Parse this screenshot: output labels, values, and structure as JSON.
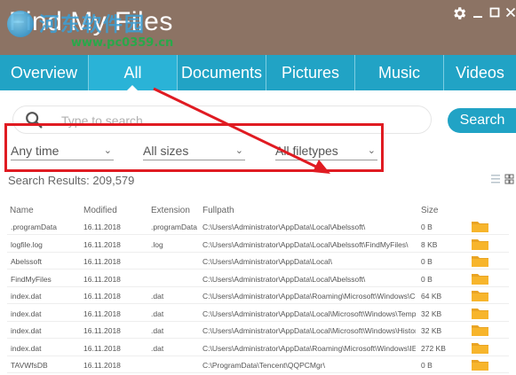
{
  "app": {
    "title": "Find My Files",
    "watermark_text": "河东软件园",
    "watermark_url": "www.pc0359.cn"
  },
  "window_controls": {
    "settings_icon": "gear-icon",
    "minimize": "▁",
    "maximize": "□",
    "close": "✕"
  },
  "tabs": [
    {
      "label": "Overview",
      "active": false
    },
    {
      "label": "All",
      "active": true
    },
    {
      "label": "Documents",
      "active": false
    },
    {
      "label": "Pictures",
      "active": false
    },
    {
      "label": "Music",
      "active": false
    },
    {
      "label": "Videos",
      "active": false
    }
  ],
  "search": {
    "placeholder": "Type to search",
    "button_label": "Search",
    "icon": "search-icon"
  },
  "filters": {
    "time": "Any time",
    "size": "All sizes",
    "filetype": "All filetypes"
  },
  "results": {
    "label": "Search Results:",
    "count": "209,579"
  },
  "table": {
    "columns": [
      "Name",
      "Modified",
      "Extension",
      "Fullpath",
      "Size"
    ],
    "rows": [
      {
        "name": ".programData",
        "modified": "16.11.2018",
        "extension": ".programData",
        "fullpath": "C:\\Users\\Administrator\\AppData\\Local\\Abelssoft\\",
        "size": "0 B"
      },
      {
        "name": "logfile.log",
        "modified": "16.11.2018",
        "extension": ".log",
        "fullpath": "C:\\Users\\Administrator\\AppData\\Local\\Abelssoft\\FindMyFiles\\",
        "size": "8 KB"
      },
      {
        "name": "Abelssoft",
        "modified": "16.11.2018",
        "extension": "",
        "fullpath": "C:\\Users\\Administrator\\AppData\\Local\\",
        "size": "0 B"
      },
      {
        "name": "FindMyFiles",
        "modified": "16.11.2018",
        "extension": "",
        "fullpath": "C:\\Users\\Administrator\\AppData\\Local\\Abelssoft\\",
        "size": "0 B"
      },
      {
        "name": "index.dat",
        "modified": "16.11.2018",
        "extension": ".dat",
        "fullpath": "C:\\Users\\Administrator\\AppData\\Roaming\\Microsoft\\Windows\\Coo...",
        "size": "64 KB"
      },
      {
        "name": "index.dat",
        "modified": "16.11.2018",
        "extension": ".dat",
        "fullpath": "C:\\Users\\Administrator\\AppData\\Local\\Microsoft\\Windows\\Tempor...",
        "size": "32 KB"
      },
      {
        "name": "index.dat",
        "modified": "16.11.2018",
        "extension": ".dat",
        "fullpath": "C:\\Users\\Administrator\\AppData\\Local\\Microsoft\\Windows\\History\\...",
        "size": "32 KB"
      },
      {
        "name": "index.dat",
        "modified": "16.11.2018",
        "extension": ".dat",
        "fullpath": "C:\\Users\\Administrator\\AppData\\Roaming\\Microsoft\\Windows\\IETl...",
        "size": "272 KB"
      },
      {
        "name": "TAVWfsDB",
        "modified": "16.11.2018",
        "extension": "",
        "fullpath": "C:\\ProgramData\\Tencent\\QQPCMgr\\",
        "size": "0 B"
      }
    ]
  },
  "colors": {
    "titlebar": "#8c7364",
    "accent": "#21a3c5",
    "annotation_red": "#e01b22",
    "folder": "#f7b52c"
  }
}
